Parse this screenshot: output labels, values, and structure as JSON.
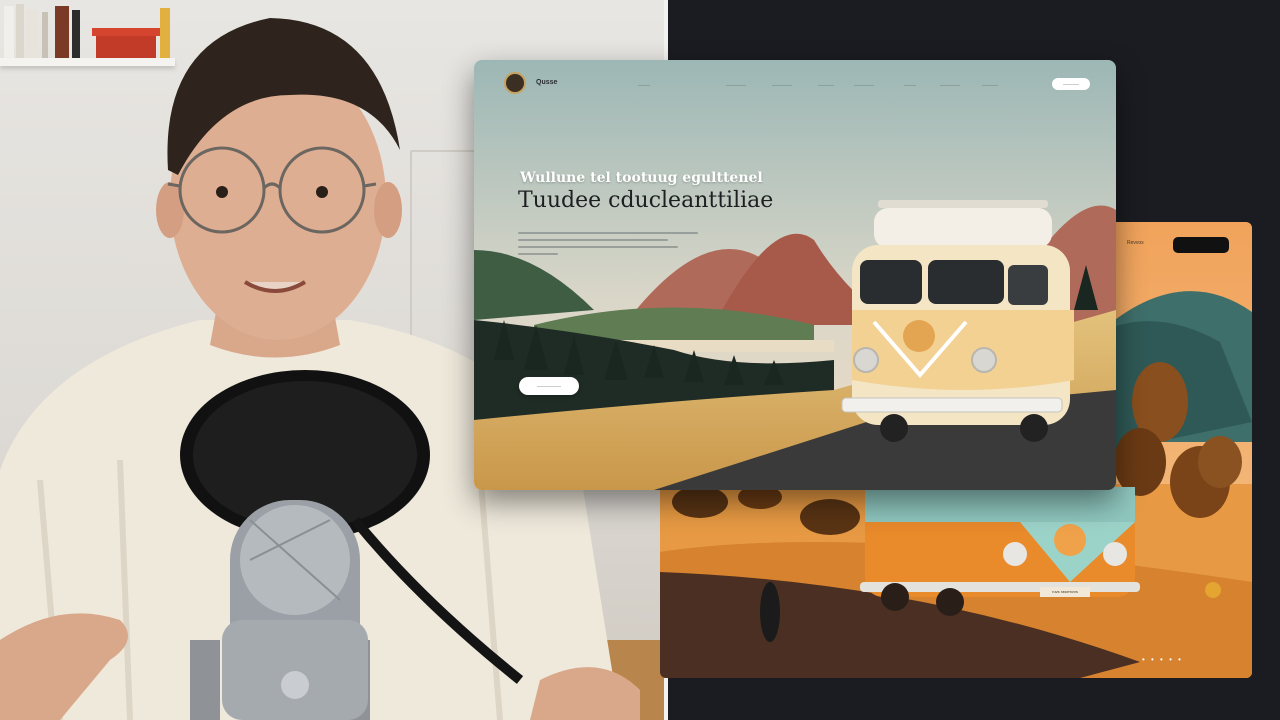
{
  "mockup_main": {
    "brand": "Qusse",
    "nav_items": [
      "———",
      "—————",
      "—————",
      "————",
      "—————",
      "———",
      "—————",
      "————"
    ],
    "nav_cta": "————",
    "subheading": "Wullune tel tootuug egulttenel",
    "heading": "Tuudee cducleanttiliae",
    "cta_label": "——————"
  },
  "mockup_back": {
    "label": "Revvos",
    "plate": "ruvs rasemvvs",
    "dots": "• • • • •"
  },
  "colors": {
    "sky_top": "#9fb8b6",
    "sky_bottom": "#efe2cf",
    "van_cream": "#f4e6c4",
    "van_orange": "#e98a2b",
    "accent_gold": "#e4a531",
    "backdrop": "#1b1c21"
  }
}
